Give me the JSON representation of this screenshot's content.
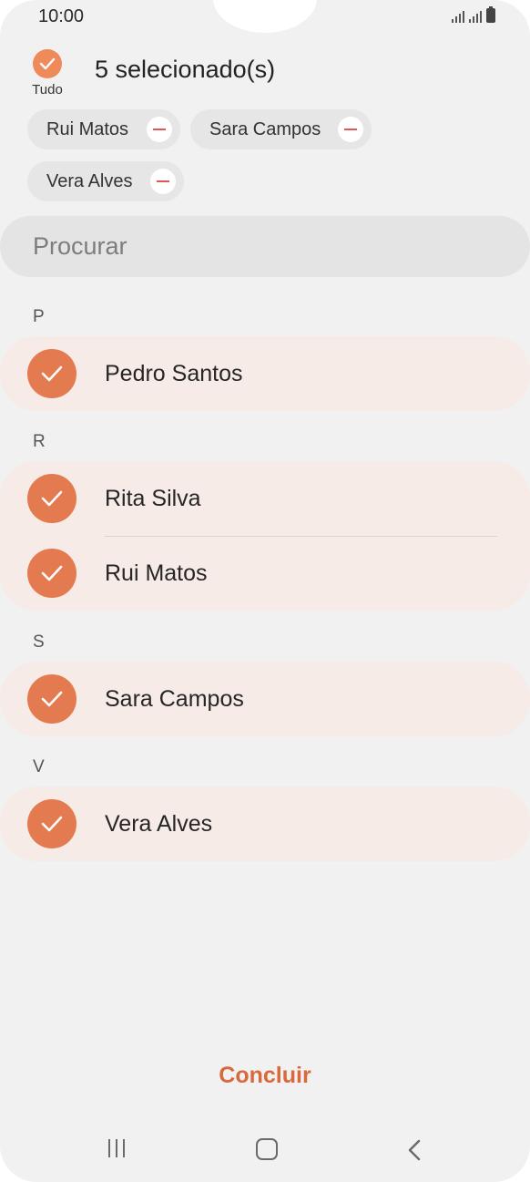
{
  "status_bar": {
    "time": "10:00"
  },
  "header": {
    "select_all_label": "Tudo",
    "selected_count": "5 selecionado(s)"
  },
  "chips": [
    {
      "label": "Rui Matos"
    },
    {
      "label": "Sara Campos"
    },
    {
      "label": "Vera Alves"
    }
  ],
  "search": {
    "placeholder": "Procurar"
  },
  "sections": [
    {
      "letter": "P",
      "contacts": [
        {
          "name": "Pedro Santos",
          "selected": true
        }
      ]
    },
    {
      "letter": "R",
      "contacts": [
        {
          "name": "Rita Silva",
          "selected": true
        },
        {
          "name": "Rui Matos",
          "selected": true
        }
      ]
    },
    {
      "letter": "S",
      "contacts": [
        {
          "name": "Sara Campos",
          "selected": true
        }
      ]
    },
    {
      "letter": "V",
      "contacts": [
        {
          "name": "Vera Alves",
          "selected": true
        }
      ]
    }
  ],
  "footer": {
    "done_label": "Concluir"
  },
  "colors": {
    "accent": "#e47a50",
    "done_text": "#d9683c",
    "selected_row_bg": "#f6ebe6",
    "remove_icon": "#e05555"
  },
  "icons": {
    "check": "check-icon",
    "remove": "minus-icon",
    "nav_recents": "recents-icon",
    "nav_home": "home-icon",
    "nav_back": "back-icon"
  }
}
